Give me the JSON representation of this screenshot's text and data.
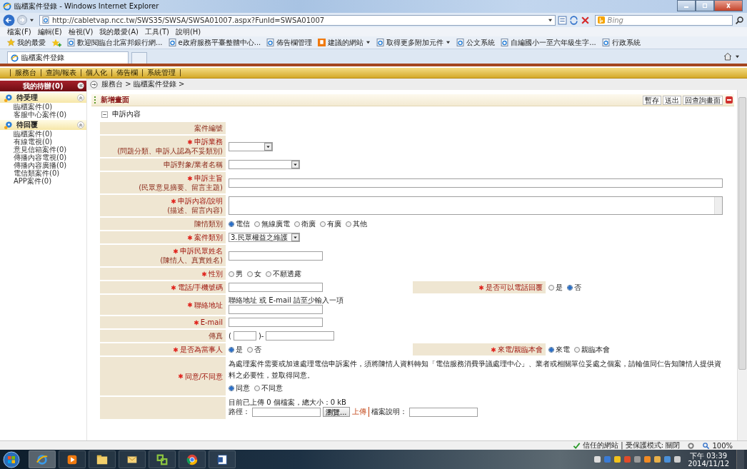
{
  "window": {
    "title": "臨櫃案件登錄 - Windows Internet Explorer"
  },
  "address_bar": {
    "url": "http://cabletvap.ncc.tw/SWS35/SWSA/SWSA01007.aspx?FunId=SWSA01007",
    "search_placeholder": "Bing"
  },
  "menu": [
    "檔案(F)",
    "編輯(E)",
    "檢視(V)",
    "我的最愛(A)",
    "工具(T)",
    "說明(H)"
  ],
  "favorites": {
    "label": "我的最愛",
    "items": [
      {
        "label": "歡迎閱臨台北富邦銀行網...",
        "kind": "page",
        "dropdown": false
      },
      {
        "label": "e政府服務平臺整體中心...",
        "kind": "page",
        "dropdown": false
      },
      {
        "label": "佈告欄管理",
        "kind": "page",
        "dropdown": false
      },
      {
        "label": "建議的網站",
        "kind": "suggested",
        "dropdown": true
      },
      {
        "label": "取得更多附加元件",
        "kind": "page",
        "dropdown": true
      },
      {
        "label": "公文系統",
        "kind": "page",
        "dropdown": false
      },
      {
        "label": "自編國小一至六年級生字...",
        "kind": "page",
        "dropdown": false
      },
      {
        "label": "行政系統",
        "kind": "page",
        "dropdown": false
      }
    ]
  },
  "tab": {
    "label": "臨櫃案件登錄"
  },
  "app_nav": [
    "服務台",
    "查詢/報表",
    "個人化",
    "佈告欄",
    "系統管理"
  ],
  "sidebar": {
    "header": "我的待辦(0)",
    "groups": [
      {
        "title": "待受理",
        "items": [
          "臨櫃案件(0)",
          "客服中心案件(0)"
        ]
      },
      {
        "title": "待回覆",
        "items": [
          "臨櫃案件(0)",
          "有線電視(0)",
          "意見信箱案件(0)",
          "傳播內容電視(0)",
          "傳播內容廣播(0)",
          "電信類案件(0)",
          "APP案件(0)"
        ]
      }
    ]
  },
  "breadcrumb": "服務台 > 臨櫃案件登錄 >",
  "panel": {
    "title": "新增畫面",
    "actions": [
      "暫存",
      "送出",
      "回查詢畫面"
    ]
  },
  "section": {
    "title": "申訴內容",
    "expanded": true
  },
  "form": {
    "rows": [
      {
        "label": "案件編號",
        "required": false,
        "field": {
          "kind": "static"
        }
      },
      {
        "label": "申訴業務",
        "required": true,
        "hint": "(問題分類、申訴人認為不妥類別)",
        "field": {
          "kind": "short_select"
        }
      },
      {
        "label": "申訴對象/業者名稱",
        "required": false,
        "field": {
          "kind": "select"
        }
      },
      {
        "label": "申訴主旨",
        "required": true,
        "hint": "(民眾意見摘要、留言主題)",
        "field": {
          "kind": "wide_input"
        }
      },
      {
        "label": "申訴內容/說明",
        "required": true,
        "hint": "(描述、留言內容)",
        "field": {
          "kind": "textarea"
        }
      },
      {
        "label": "陳情類別",
        "required": false,
        "field": {
          "kind": "radio",
          "options": [
            {
              "label": "電信",
              "selected": true
            },
            {
              "label": "無線廣電",
              "selected": false
            },
            {
              "label": "衛廣",
              "selected": false
            },
            {
              "label": "有廣",
              "selected": false
            },
            {
              "label": "其他",
              "selected": false
            }
          ]
        }
      },
      {
        "label": "案件類別",
        "required": true,
        "field": {
          "kind": "select",
          "value": "3.民眾權益之維護"
        }
      },
      {
        "label": "申訴民眾姓名",
        "required": true,
        "hint": "(陳情人、真實姓名)",
        "field": {
          "kind": "input"
        }
      },
      {
        "label": "性別",
        "required": true,
        "field": {
          "kind": "radio",
          "options": [
            {
              "label": "男",
              "selected": false
            },
            {
              "label": "女",
              "selected": false
            },
            {
              "label": "不願透露",
              "selected": false
            }
          ]
        }
      },
      {
        "label": "電話/手機號碼",
        "required": true,
        "field": {
          "kind": "input"
        },
        "side": {
          "label": "是否可以電話回覆",
          "required": true,
          "field": {
            "kind": "radio",
            "options": [
              {
                "label": "是",
                "selected": false
              },
              {
                "label": "否",
                "selected": true
              }
            ]
          }
        }
      },
      {
        "label": "聯絡地址",
        "required": true,
        "field": {
          "kind": "address",
          "note": "聯絡地址 或 E-mail 請至少輸入一項"
        }
      },
      {
        "label": "E-mail",
        "required": true,
        "field": {
          "kind": "input"
        }
      },
      {
        "label": "傳真",
        "required": false,
        "field": {
          "kind": "fax",
          "open": "(",
          "sep": ")-"
        }
      },
      {
        "label": "是否為當事人",
        "required": true,
        "field": {
          "kind": "radio",
          "options": [
            {
              "label": "是",
              "selected": true
            },
            {
              "label": "否",
              "selected": false
            }
          ]
        },
        "side": {
          "label": "來電/親臨本會",
          "required": true,
          "field": {
            "kind": "radio",
            "options": [
              {
                "label": "來電",
                "selected": true
              },
              {
                "label": "親臨本會",
                "selected": false
              }
            ]
          }
        }
      },
      {
        "label": "同意/不同意",
        "required": true,
        "field": {
          "kind": "consent",
          "text": "為處理案件需要或加速處理電信申訴案件，須將陳情人資料轉知「電信服務消費爭議處理中心」、業者或相關單位妥處之個案，請輪值同仁告知陳情人提供資料之必要性，並取得同意。",
          "options": [
            {
              "label": "同意",
              "selected": true
            },
            {
              "label": "不同意",
              "selected": false
            }
          ]
        }
      },
      {
        "field": {
          "kind": "upload",
          "status": "目前已上傳 0 個檔案，總大小：0 kB",
          "path_label": "路徑：",
          "browse": "瀏覽...",
          "upload": "上傳",
          "desc_label": "檔案說明："
        }
      }
    ]
  },
  "status_bar": {
    "zone": "信任的網站 | 受保護模式: 關閉",
    "zoom": "100%"
  },
  "taskbar": {
    "time": "下午 03:39",
    "date": "2014/11/12"
  }
}
